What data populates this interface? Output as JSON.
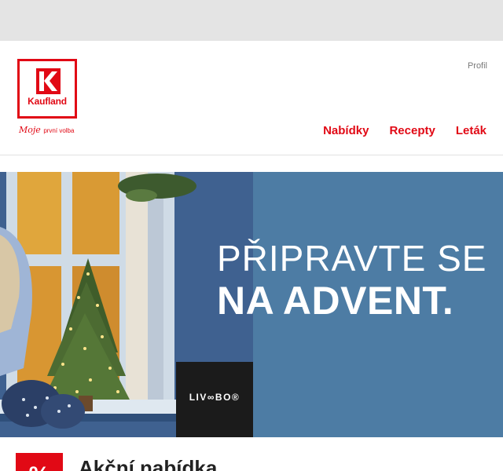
{
  "header": {
    "logo_text": "Kaufland",
    "tagline_script": "Moje",
    "tagline_small": "první volba",
    "profile_label": "Profil",
    "nav": [
      "Nabídky",
      "Recepty",
      "Leták"
    ]
  },
  "hero": {
    "line1": "PŘIPRAVTE SE",
    "line2": "NA ADVENT.",
    "brand": "LIV∞BO®",
    "image_alt": "Advent decoration photo"
  },
  "section": {
    "badge": "%",
    "title": "Akční nabídka"
  },
  "colors": {
    "brand_red": "#e10915",
    "hero_blue": "#4d7ca4",
    "top_bar": "#e4e4e4"
  }
}
